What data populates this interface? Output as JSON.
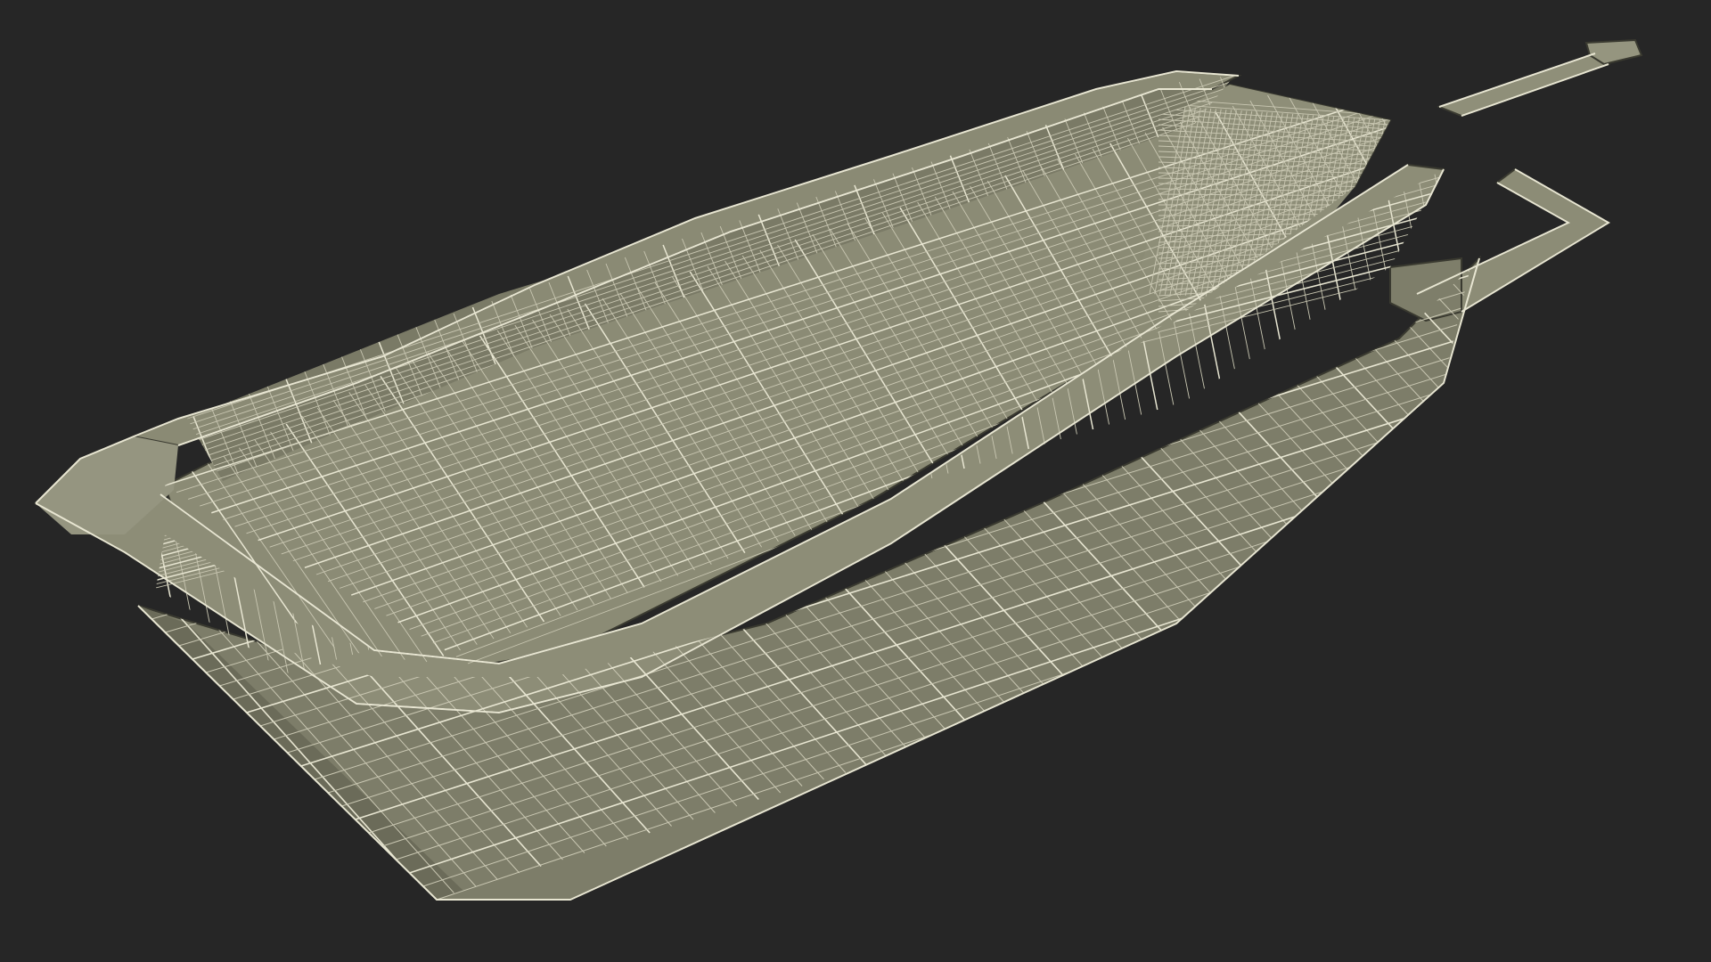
{
  "scene": {
    "subject": "wireframe-sled",
    "colors": {
      "background": "#262626",
      "surface": "#84846f",
      "surface_dark": "#6d6d5b",
      "surface_light": "#969680",
      "wire": "#e8e6d2",
      "wire_dim": "#c9c7b2",
      "edge": "#3a3a30"
    }
  }
}
